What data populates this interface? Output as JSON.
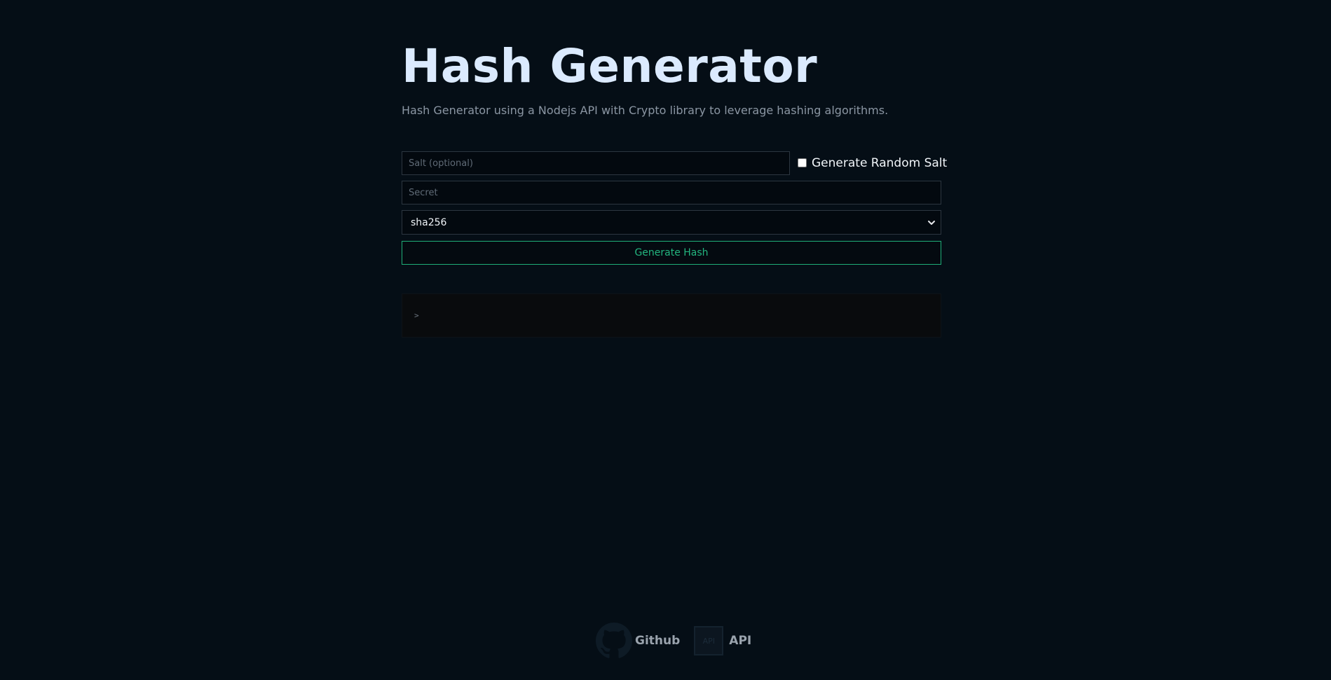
{
  "header": {
    "title": "Hash Generator",
    "subtitle": "Hash Generator using a Nodejs API with Crypto library to leverage hashing algorithms."
  },
  "form": {
    "salt_placeholder": "Salt (optional)",
    "salt_value": "",
    "random_salt_label": "Generate Random Salt",
    "random_salt_checked": false,
    "secret_placeholder": "Secret",
    "secret_value": "",
    "algorithm": "sha256",
    "generate_label": "Generate Hash"
  },
  "output": {
    "prompt": ">"
  },
  "footer": {
    "github_label": "Github",
    "api_icon_text": "API",
    "api_label": "API"
  },
  "colors": {
    "background": "#050e16",
    "title": "#dbeafe",
    "accent": "#23b57f"
  },
  "icons": {
    "github": "github-icon",
    "api": "api-icon",
    "select": "chevron-down-icon"
  }
}
